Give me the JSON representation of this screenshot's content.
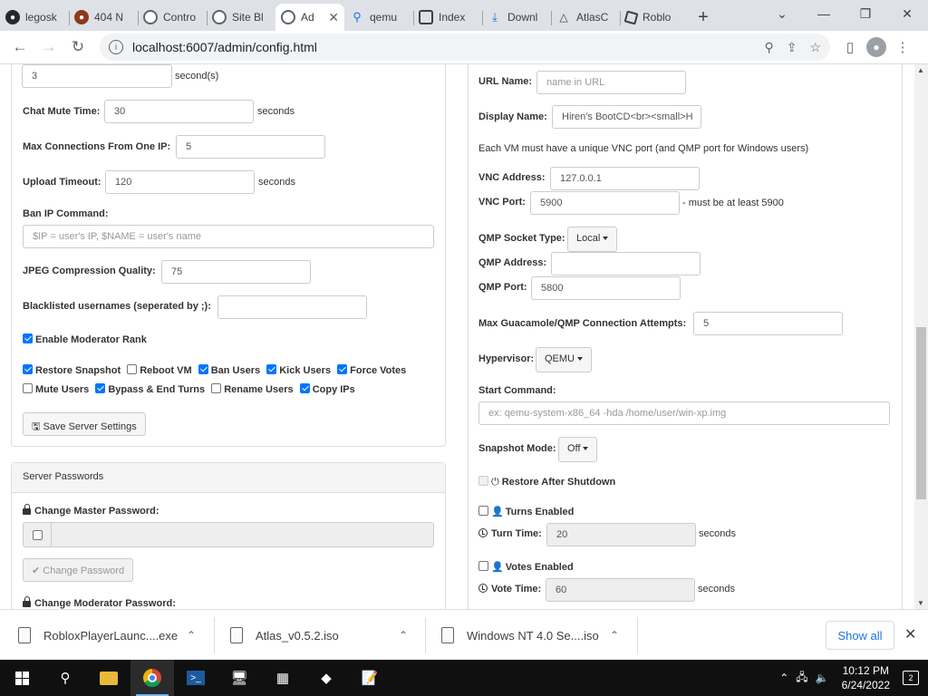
{
  "browser": {
    "tabs": [
      {
        "title": "legosk",
        "icon": "github-icon"
      },
      {
        "title": "404 N",
        "icon": "error-page-icon"
      },
      {
        "title": "Contro",
        "icon": "globe-icon"
      },
      {
        "title": "Site Bl",
        "icon": "globe-icon"
      },
      {
        "title": "Ad",
        "icon": "globe-icon",
        "active": true
      },
      {
        "title": "qemu",
        "icon": "search-icon"
      },
      {
        "title": "Index",
        "icon": "index-icon"
      },
      {
        "title": "Downl",
        "icon": "download-icon"
      },
      {
        "title": "AtlasC",
        "icon": "atlas-icon"
      },
      {
        "title": "Roblo",
        "icon": "roblox-icon"
      }
    ],
    "url": "localhost:6007/admin/config.html"
  },
  "left": {
    "top_input_value": "3",
    "top_unit": "second(s)",
    "chat_mute_label": "Chat Mute Time:",
    "chat_mute_value": "30",
    "seconds": "seconds",
    "max_conn_label": "Max Connections From One IP:",
    "max_conn_value": "5",
    "upload_timeout_label": "Upload Timeout:",
    "upload_timeout_value": "120",
    "ban_ip_label": "Ban IP Command:",
    "ban_ip_placeholder": "$IP = user's IP, $NAME = user's name",
    "jpeg_label": "JPEG Compression Quality:",
    "jpeg_value": "75",
    "blacklist_label": "Blacklisted usernames (seperated by ;):",
    "blacklist_value": "",
    "enable_mod_rank": "Enable Moderator Rank",
    "perms": {
      "restore_snapshot": "Restore Snapshot",
      "reboot_vm": "Reboot VM",
      "ban_users": "Ban Users",
      "kick_users": "Kick Users",
      "force_votes": "Force Votes",
      "mute_users": "Mute Users",
      "bypass_end_turns": "Bypass & End Turns",
      "rename_users": "Rename Users",
      "copy_ips": "Copy IPs"
    },
    "save_button": "Save Server Settings"
  },
  "passwords": {
    "heading": "Server Passwords",
    "master_label": "Change Master Password:",
    "change_button": "Change Password",
    "moderator_label": "Change Moderator Password:"
  },
  "right": {
    "url_name_label": "URL Name:",
    "url_name_placeholder": "name in URL",
    "display_name_label": "Display Name:",
    "display_name_value": "Hiren's BootCD<br><small>H",
    "vnc_note": "Each VM must have a unique VNC port (and QMP port for Windows users)",
    "vnc_address_label": "VNC Address:",
    "vnc_address_value": "127.0.0.1",
    "vnc_port_label": "VNC Port:",
    "vnc_port_value": "5900",
    "vnc_port_hint": "- must be at least 5900",
    "qmp_socket_label": "QMP Socket Type:",
    "qmp_socket_value": "Local",
    "qmp_address_label": "QMP Address:",
    "qmp_address_value": "",
    "qmp_port_label": "QMP Port:",
    "qmp_port_value": "5800",
    "max_guac_label": "Max Guacamole/QMP Connection Attempts:",
    "max_guac_value": "5",
    "hypervisor_label": "Hypervisor:",
    "hypervisor_value": "QEMU",
    "start_cmd_label": "Start Command:",
    "start_cmd_placeholder": "ex: qemu-system-x86_64 -hda /home/user/win-xp.img",
    "snapshot_mode_label": "Snapshot Mode:",
    "snapshot_mode_value": "Off",
    "restore_after_shutdown": "Restore After Shutdown",
    "turns_enabled": "Turns Enabled",
    "turn_time_label": "Turn Time:",
    "turn_time_value": "20",
    "votes_enabled": "Votes Enabled",
    "vote_time_label": "Vote Time:",
    "vote_time_value": "60",
    "seconds": "seconds"
  },
  "downloads": {
    "items": [
      "RobloxPlayerLaunc....exe",
      "Atlas_v0.5.2.iso",
      "Windows NT 4.0 Se....iso"
    ],
    "show_all": "Show all"
  },
  "taskbar": {
    "time": "10:12 PM",
    "date": "6/24/2022",
    "notifications": "2"
  }
}
